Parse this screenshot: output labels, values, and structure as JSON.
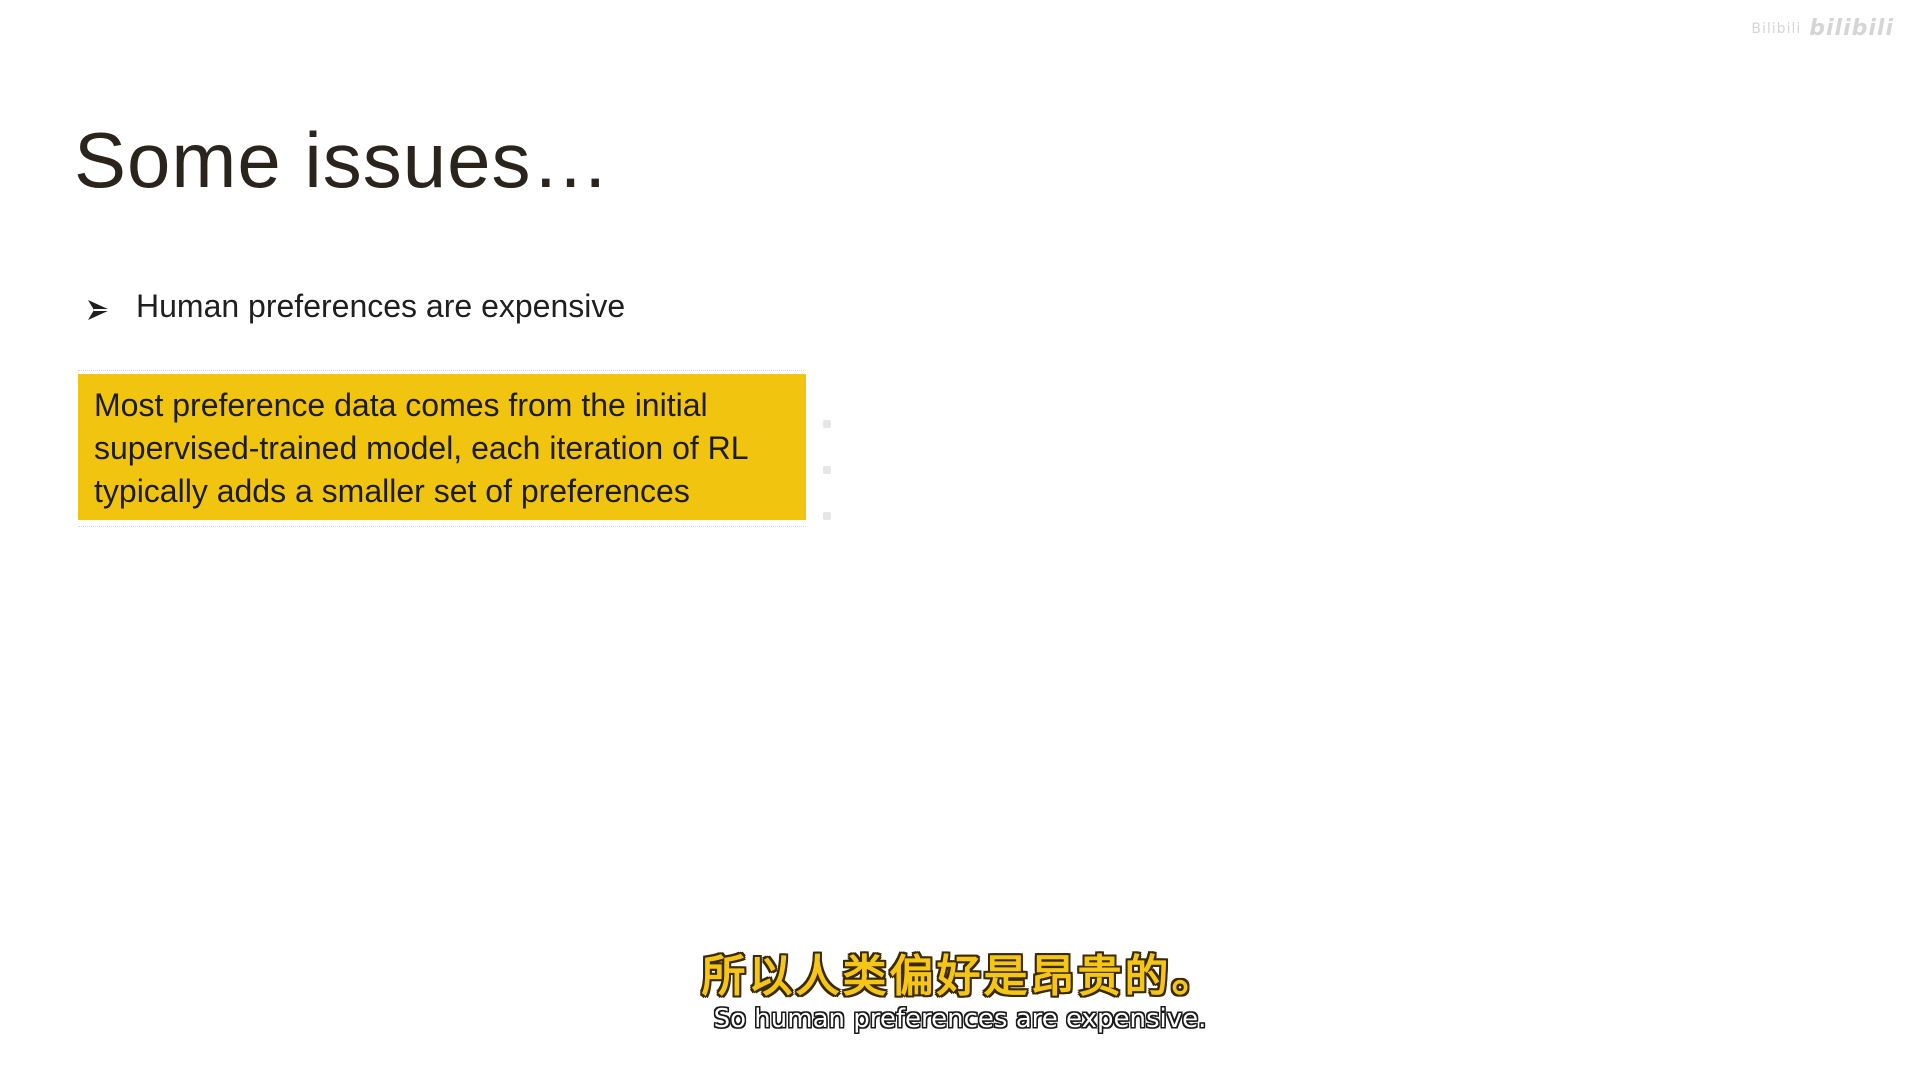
{
  "watermark": {
    "text": "Bilibili",
    "logo": "bilibili"
  },
  "slide": {
    "title": "Some issues…",
    "bullet": {
      "icon": "arrow-bullet-icon",
      "text": "Human preferences are expensive"
    },
    "highlight": {
      "lines": [
        "Most preference data comes from the initial",
        "supervised-trained model, each iteration of RL",
        "typically adds a smaller set of preferences"
      ],
      "color": "#f1c40f"
    }
  },
  "subtitles": {
    "chinese": "所以人类偏好是昂贵的。",
    "english": "So human preferences are expensive."
  }
}
